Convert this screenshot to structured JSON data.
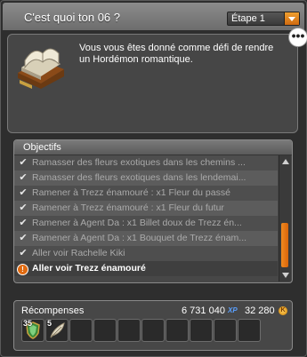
{
  "window": {
    "title": "C'est quoi ton 06 ?",
    "step_select": {
      "selected": "Étape 1"
    }
  },
  "quest": {
    "description": "Vous vous êtes donné comme défi de rendre un Hordémon romantique.",
    "more_button_label": "•••",
    "icon": "book-icon"
  },
  "objectives": {
    "header": "Objectifs",
    "items": [
      {
        "text": "Ramasser des fleurs exotiques dans les chemins ...",
        "status": "done"
      },
      {
        "text": "Ramasser des fleurs exotiques dans les lendemai...",
        "status": "done"
      },
      {
        "text": "Ramener à Trezz énamouré : x1 Fleur du passé",
        "status": "done"
      },
      {
        "text": "Ramener à Trezz énamouré : x1 Fleur du futur",
        "status": "done"
      },
      {
        "text": "Ramener à Agent Da : x1 Billet doux de Trezz én...",
        "status": "done"
      },
      {
        "text": "Ramener à Agent Da : x1 Bouquet de Trezz énam...",
        "status": "done"
      },
      {
        "text": "Aller voir Rachelle Kiki",
        "status": "done"
      },
      {
        "text": "Aller voir Trezz énamouré",
        "status": "active"
      }
    ],
    "check_glyph": "✔",
    "active_glyph": "!"
  },
  "rewards": {
    "title": "Récompenses",
    "xp": "6 731 040",
    "xp_label": "XP",
    "kamas": "32 280",
    "kama_symbol": "K",
    "items": [
      {
        "qty": "35",
        "icon": "shield-item-icon"
      },
      {
        "qty": "5",
        "icon": "feather-item-icon"
      }
    ],
    "empty_slots": 8
  },
  "colors": {
    "accent": "#e07a18",
    "panel": "#474747",
    "header": "#7d7d7d"
  }
}
